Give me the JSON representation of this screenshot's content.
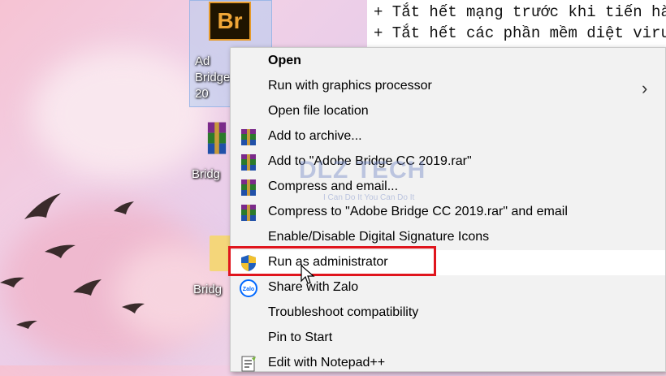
{
  "notepad": {
    "line1": "+ Tắt hết mạng trước khi tiến hà",
    "line2": "+ Tắt hết các phần mềm diệt viru"
  },
  "desktop": {
    "icons": [
      {
        "label": "Ad Bridge 20",
        "icon": "adobe-bridge-icon",
        "icon_text": "Br"
      },
      {
        "label": "Bridg",
        "icon": "winrar-archive-icon"
      },
      {
        "label": "Bridg",
        "icon": "folder-icon"
      }
    ]
  },
  "menu": {
    "items": [
      {
        "label": "Open",
        "bold": true,
        "icon": ""
      },
      {
        "label": "Run with graphics processor",
        "icon": "",
        "submenu": true
      },
      {
        "label": "Open file location",
        "icon": ""
      },
      {
        "label": "Add to archive...",
        "icon": "winrar-icon"
      },
      {
        "label": "Add to \"Adobe Bridge CC 2019.rar\"",
        "icon": "winrar-icon"
      },
      {
        "label": "Compress and email...",
        "icon": "winrar-icon"
      },
      {
        "label": "Compress to \"Adobe Bridge CC 2019.rar\" and email",
        "icon": "winrar-icon"
      },
      {
        "label": "Enable/Disable Digital Signature Icons",
        "icon": ""
      },
      {
        "label": "Run as administrator",
        "icon": "uac-shield-icon",
        "highlighted": true
      },
      {
        "label": "Share with Zalo",
        "icon": "zalo-icon"
      },
      {
        "label": "Troubleshoot compatibility",
        "icon": ""
      },
      {
        "label": "Pin to Start",
        "icon": ""
      },
      {
        "label": "Edit with Notepad++",
        "icon": "notepadpp-icon"
      }
    ],
    "submenu_glyph": "›"
  },
  "watermark": {
    "brand": "DLZ TECH",
    "slogan": "I Can Do It You Can Do It"
  },
  "colors": {
    "highlight_box": "#e0151d",
    "menu_bg": "#f2f2f2"
  }
}
